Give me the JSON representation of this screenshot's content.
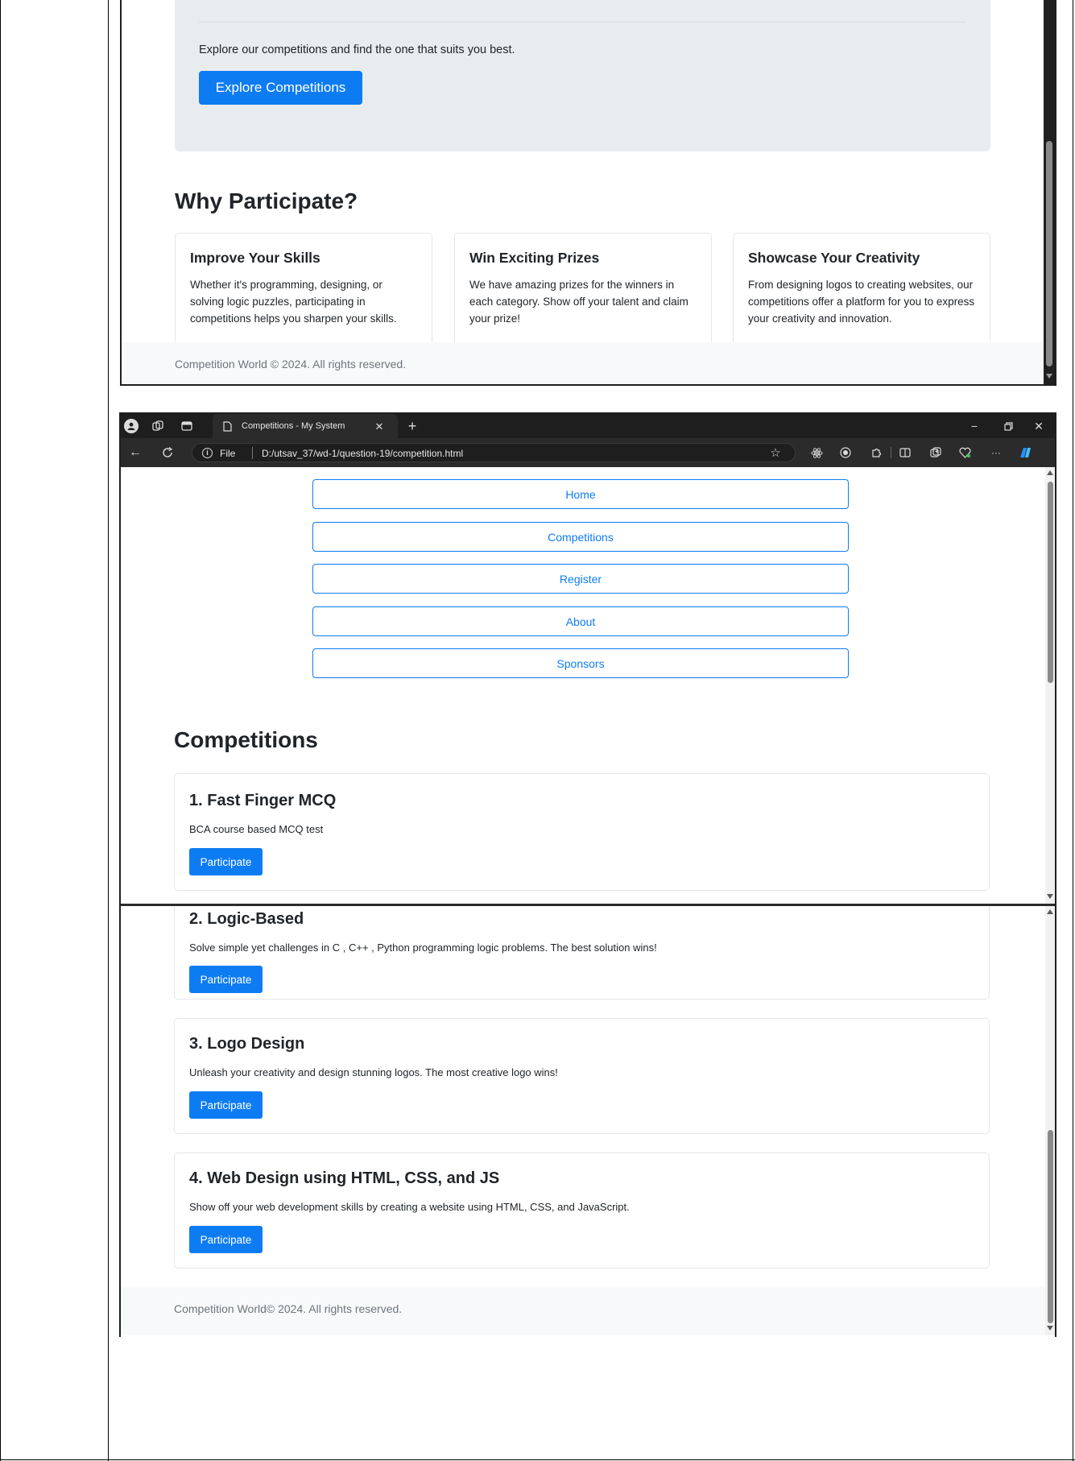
{
  "top_section": {
    "jumbotron_text": "Explore our competitions and find the one that suits you best.",
    "explore_button": "Explore Competitions",
    "why_heading": "Why Participate?",
    "cards": [
      {
        "title": "Improve Your Skills",
        "text": "Whether it's programming, designing, or solving logic puzzles, participating in competitions helps you sharpen your skills."
      },
      {
        "title": "Win Exciting Prizes",
        "text": "We have amazing prizes for the winners in each category. Show off your talent and claim your prize!"
      },
      {
        "title": "Showcase Your Creativity",
        "text": "From designing logos to creating websites, our competitions offer a platform for you to express your creativity and innovation."
      }
    ],
    "footer": "Competition World © 2024. All rights reserved."
  },
  "browser": {
    "tab_title": "Competitions - My System",
    "new_tab_symbol": "+",
    "file_label": "File",
    "url": "D:/utsav_37/wd-1/question-19/competition.html",
    "more_symbol": "···",
    "minimize_symbol": "−",
    "close_symbol": "✕"
  },
  "nav": {
    "items": [
      "Home",
      "Competitions",
      "Register",
      "About",
      "Sponsors"
    ]
  },
  "competitions": {
    "heading": "Competitions",
    "items": [
      {
        "title": "1. Fast Finger MCQ",
        "desc": "BCA course based MCQ test",
        "button": "Participate"
      },
      {
        "title": "2. Logic-Based",
        "desc": "Solve simple yet challenges in C , C++ , Python programming logic problems. The best solution wins!",
        "button": "Participate"
      },
      {
        "title": "3. Logo Design",
        "desc": "Unleash your creativity and design stunning logos. The most creative logo wins!",
        "button": "Participate"
      },
      {
        "title": "4. Web Design using HTML, CSS, and JS",
        "desc": "Show off your web development skills by creating a website using HTML, CSS, and JavaScript.",
        "button": "Participate"
      }
    ],
    "footer": "Competition World© 2024. All rights reserved."
  }
}
